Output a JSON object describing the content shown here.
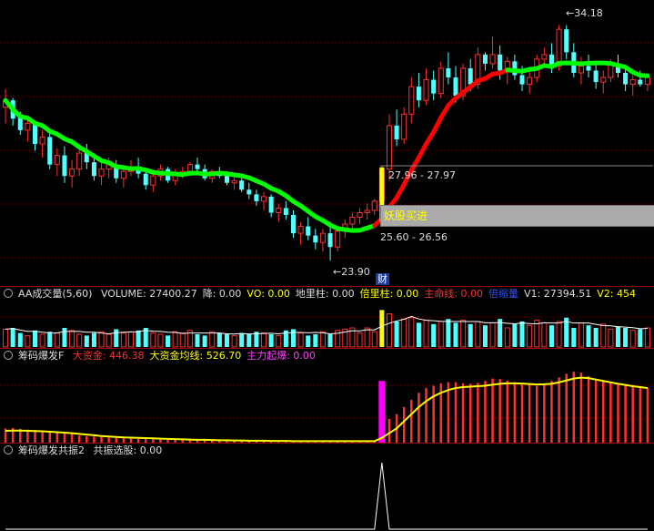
{
  "panels": {
    "volume": {
      "title": "AA成交量(5,60)",
      "items": [
        {
          "label": "VOLUME: 27400.27",
          "color": "#dddddd"
        },
        {
          "label": "降: 0.00",
          "color": "#dddddd"
        },
        {
          "label": "VO: 0.00",
          "color": "#ffff00"
        },
        {
          "label": "地里柱: 0.00",
          "color": "#dddddd"
        },
        {
          "label": "倍里柱: 0.00",
          "color": "#ffff00"
        },
        {
          "label": "主命线: 0.00",
          "color": "#ff3030"
        },
        {
          "label": "倍缩量",
          "color": "#3050ff"
        },
        {
          "label": "V1: 27394.51",
          "color": "#dddddd"
        },
        {
          "label": "V2: 454",
          "color": "#ffff00"
        }
      ]
    },
    "chip": {
      "title": "筹码爆发F",
      "items": [
        {
          "label": "大资金: 446.38",
          "color": "#ff3030"
        },
        {
          "label": "大资金均线: 526.70",
          "color": "#ffff00"
        },
        {
          "label": "主力起爆: 0.00",
          "color": "#ff40ff"
        }
      ]
    },
    "resonance": {
      "title": "筹码爆发共振2",
      "items": [
        {
          "label": "共振选股: 0.00",
          "color": "#dddddd"
        }
      ]
    }
  },
  "annotations": {
    "high_price": "34.18",
    "low_price": "23.90",
    "range_upper": "27.96 - 27.97",
    "range_lower": "25.60 - 26.56",
    "signal_text": "妖股买进",
    "finance_badge": "财"
  },
  "colors": {
    "up": "#ff3030",
    "down": "#54ffff",
    "ma_up": "#ff0000",
    "ma_down": "#00ff00",
    "avg_line": "#ffff00",
    "grid": "#800000",
    "signal": "#ffff00",
    "explode": "#ff00ff"
  },
  "chart_data": {
    "type": "candlestick",
    "candles": [
      [
        30.6,
        31.4,
        29.9,
        30.9
      ],
      [
        30.9,
        31.0,
        29.8,
        30.1
      ],
      [
        30.2,
        30.4,
        29.4,
        29.6
      ],
      [
        29.6,
        30.1,
        29.1,
        29.9
      ],
      [
        29.9,
        30.0,
        28.7,
        29.0
      ],
      [
        29.0,
        29.6,
        28.4,
        29.3
      ],
      [
        29.3,
        29.5,
        27.9,
        28.1
      ],
      [
        28.1,
        28.8,
        27.6,
        28.5
      ],
      [
        28.5,
        28.9,
        27.3,
        27.6
      ],
      [
        27.6,
        28.3,
        27.1,
        27.9
      ],
      [
        27.9,
        28.8,
        27.6,
        28.6
      ],
      [
        28.6,
        29.0,
        27.9,
        28.2
      ],
      [
        28.2,
        28.5,
        27.4,
        27.6
      ],
      [
        27.6,
        28.2,
        27.2,
        27.9
      ],
      [
        27.9,
        28.4,
        27.5,
        28.1
      ],
      [
        28.1,
        28.3,
        27.3,
        27.5
      ],
      [
        27.5,
        28.0,
        27.1,
        27.8
      ],
      [
        27.8,
        28.3,
        27.6,
        28.0
      ],
      [
        28.0,
        28.4,
        27.5,
        27.7
      ],
      [
        27.7,
        27.9,
        27.0,
        27.2
      ],
      [
        27.2,
        27.8,
        26.9,
        27.6
      ],
      [
        27.6,
        28.1,
        27.4,
        27.9
      ],
      [
        27.9,
        28.0,
        27.3,
        27.4
      ],
      [
        27.4,
        27.9,
        27.2,
        27.7
      ],
      [
        27.7,
        28.0,
        27.5,
        27.8
      ],
      [
        27.8,
        28.2,
        27.6,
        28.1
      ],
      [
        28.1,
        28.4,
        27.7,
        27.9
      ],
      [
        27.9,
        28.1,
        27.4,
        27.5
      ],
      [
        27.5,
        27.9,
        27.3,
        27.8
      ],
      [
        27.8,
        28.0,
        27.5,
        27.6
      ],
      [
        27.6,
        27.8,
        27.2,
        27.3
      ],
      [
        27.3,
        27.6,
        27.0,
        27.4
      ],
      [
        27.4,
        27.5,
        26.9,
        27.0
      ],
      [
        27.0,
        27.3,
        26.6,
        26.8
      ],
      [
        26.8,
        27.0,
        26.3,
        26.5
      ],
      [
        26.5,
        26.9,
        26.1,
        26.7
      ],
      [
        26.7,
        26.8,
        25.8,
        26.0
      ],
      [
        26.0,
        26.4,
        25.6,
        26.2
      ],
      [
        26.2,
        26.5,
        25.7,
        25.9
      ],
      [
        25.9,
        26.1,
        24.9,
        25.1
      ],
      [
        25.1,
        25.6,
        24.6,
        25.4
      ],
      [
        25.4,
        25.8,
        24.8,
        25.0
      ],
      [
        25.0,
        25.3,
        24.4,
        24.7
      ],
      [
        24.7,
        25.3,
        24.3,
        25.1
      ],
      [
        25.1,
        25.6,
        23.9,
        24.5
      ],
      [
        24.5,
        25.4,
        24.3,
        25.2
      ],
      [
        25.2,
        25.7,
        24.9,
        25.5
      ],
      [
        25.5,
        26.0,
        25.2,
        25.8
      ],
      [
        25.8,
        26.2,
        25.5,
        26.0
      ],
      [
        26.0,
        26.4,
        25.7,
        26.1
      ],
      [
        26.1,
        26.6,
        25.9,
        26.5
      ],
      [
        26.5,
        28.0,
        26.3,
        27.9
      ],
      [
        27.9,
        30.3,
        27.4,
        29.8
      ],
      [
        29.8,
        30.5,
        28.9,
        29.2
      ],
      [
        29.2,
        30.6,
        29.0,
        30.3
      ],
      [
        30.3,
        31.9,
        29.9,
        31.5
      ],
      [
        31.5,
        32.1,
        30.6,
        30.9
      ],
      [
        30.9,
        32.3,
        30.7,
        31.8
      ],
      [
        31.8,
        32.2,
        30.9,
        31.2
      ],
      [
        31.2,
        32.6,
        31.0,
        32.3
      ],
      [
        32.3,
        33.0,
        31.6,
        31.9
      ],
      [
        31.9,
        32.4,
        30.8,
        31.1
      ],
      [
        31.1,
        32.5,
        30.9,
        32.3
      ],
      [
        32.3,
        32.7,
        31.3,
        31.6
      ],
      [
        31.6,
        33.2,
        31.4,
        32.9
      ],
      [
        32.9,
        33.0,
        32.2,
        32.5
      ],
      [
        32.5,
        33.7,
        32.3,
        32.9
      ],
      [
        32.9,
        33.3,
        31.8,
        32.2
      ],
      [
        32.2,
        32.8,
        31.6,
        32.6
      ],
      [
        32.6,
        32.9,
        31.8,
        32.0
      ],
      [
        32.0,
        32.4,
        31.3,
        31.6
      ],
      [
        31.6,
        32.3,
        31.2,
        31.9
      ],
      [
        31.9,
        32.9,
        31.7,
        32.7
      ],
      [
        32.7,
        33.2,
        32.3,
        32.9
      ],
      [
        32.9,
        33.4,
        32.1,
        32.4
      ],
      [
        32.4,
        34.2,
        32.2,
        34.0
      ],
      [
        34.0,
        34.18,
        32.7,
        33.0
      ],
      [
        33.0,
        33.4,
        31.9,
        32.1
      ],
      [
        32.1,
        32.8,
        31.6,
        32.4
      ],
      [
        32.4,
        32.9,
        31.9,
        32.2
      ],
      [
        32.2,
        32.6,
        31.4,
        31.7
      ],
      [
        31.7,
        32.2,
        31.2,
        31.9
      ],
      [
        31.9,
        32.7,
        31.7,
        32.5
      ],
      [
        32.5,
        32.9,
        31.9,
        32.1
      ],
      [
        32.1,
        32.4,
        31.3,
        31.6
      ],
      [
        31.6,
        32.0,
        31.1,
        31.8
      ],
      [
        31.8,
        32.2,
        31.5,
        31.6
      ],
      [
        31.6,
        32.0,
        31.3,
        31.9
      ]
    ],
    "volume": [
      28,
      30,
      22,
      18,
      26,
      20,
      24,
      22,
      30,
      26,
      20,
      18,
      22,
      24,
      20,
      28,
      22,
      24,
      26,
      30,
      22,
      20,
      18,
      24,
      22,
      26,
      20,
      18,
      24,
      22,
      20,
      18,
      22,
      20,
      24,
      22,
      20,
      18,
      26,
      28,
      22,
      18,
      20,
      24,
      20,
      26,
      28,
      30,
      22,
      30,
      24,
      58,
      52,
      40,
      44,
      46,
      38,
      42,
      36,
      40,
      44,
      38,
      42,
      36,
      40,
      34,
      38,
      44,
      30,
      36,
      40,
      34,
      42,
      38,
      34,
      40,
      46,
      30,
      38,
      34,
      30,
      36,
      28,
      32,
      30,
      26,
      28,
      30
    ],
    "capital": [
      60,
      62,
      58,
      55,
      54,
      50,
      46,
      42,
      40,
      36,
      30,
      28,
      26,
      24,
      22,
      20,
      18,
      17,
      16,
      15,
      14,
      13,
      12,
      12,
      11,
      10,
      10,
      9,
      9,
      8,
      8,
      7,
      7,
      7,
      6,
      6,
      6,
      6,
      5,
      5,
      5,
      5,
      5,
      5,
      5,
      5,
      5,
      5,
      5,
      5,
      5,
      80,
      100,
      120,
      150,
      180,
      210,
      230,
      240,
      250,
      255,
      255,
      250,
      248,
      252,
      260,
      270,
      268,
      262,
      255,
      250,
      245,
      240,
      250,
      260,
      275,
      290,
      300,
      295,
      280,
      270,
      262,
      255,
      250,
      245,
      240,
      236,
      232
    ],
    "capital_avg": [
      50,
      51,
      51,
      50,
      49,
      48,
      46,
      44,
      42,
      40,
      37,
      34,
      31,
      28,
      26,
      24,
      22,
      21,
      20,
      19,
      18,
      17,
      16,
      15,
      14,
      13,
      12,
      12,
      11,
      10,
      10,
      9,
      9,
      8,
      8,
      8,
      7,
      7,
      7,
      6,
      6,
      6,
      6,
      6,
      6,
      6,
      6,
      6,
      6,
      6,
      6,
      20,
      40,
      60,
      90,
      120,
      150,
      175,
      195,
      210,
      222,
      230,
      234,
      236,
      238,
      240,
      244,
      248,
      250,
      250,
      249,
      247,
      245,
      246,
      248,
      254,
      262,
      270,
      274,
      272,
      266,
      260,
      254,
      248,
      243,
      238,
      234,
      230
    ],
    "explode": [
      0,
      0,
      0,
      0,
      0,
      0,
      0,
      0,
      0,
      0,
      0,
      0,
      0,
      0,
      0,
      0,
      0,
      0,
      0,
      0,
      0,
      0,
      0,
      0,
      0,
      0,
      0,
      0,
      0,
      0,
      0,
      0,
      0,
      0,
      0,
      0,
      0,
      0,
      0,
      0,
      0,
      0,
      0,
      0,
      0,
      0,
      0,
      0,
      0,
      0,
      0,
      260,
      0,
      0,
      0,
      0,
      0,
      0,
      0,
      0,
      0,
      0,
      0,
      0,
      0,
      0,
      0,
      0,
      0,
      0,
      0,
      0,
      0,
      0,
      0,
      0,
      0,
      0,
      0,
      0,
      0,
      0,
      0,
      0,
      0,
      0,
      0,
      0
    ],
    "resonance": [
      0,
      0,
      0,
      0,
      0,
      0,
      0,
      0,
      0,
      0,
      0,
      0,
      0,
      0,
      0,
      0,
      0,
      0,
      0,
      0,
      0,
      0,
      0,
      0,
      0,
      0,
      0,
      0,
      0,
      0,
      0,
      0,
      0,
      0,
      0,
      0,
      0,
      0,
      0,
      0,
      0,
      0,
      0,
      0,
      0,
      0,
      0,
      0,
      0,
      0,
      0,
      1,
      0,
      0,
      0,
      0,
      0,
      0,
      0,
      0,
      0,
      0,
      0,
      0,
      0,
      0,
      0,
      0,
      0,
      0,
      0,
      0,
      0,
      0,
      0,
      0,
      0,
      0,
      0,
      0,
      0,
      0,
      0,
      0,
      0,
      0,
      0,
      0
    ],
    "signal_index": 51,
    "ma_period": 10,
    "price_range": [
      22.8,
      35.2
    ],
    "volume_max": 70,
    "capital_max": 330
  }
}
